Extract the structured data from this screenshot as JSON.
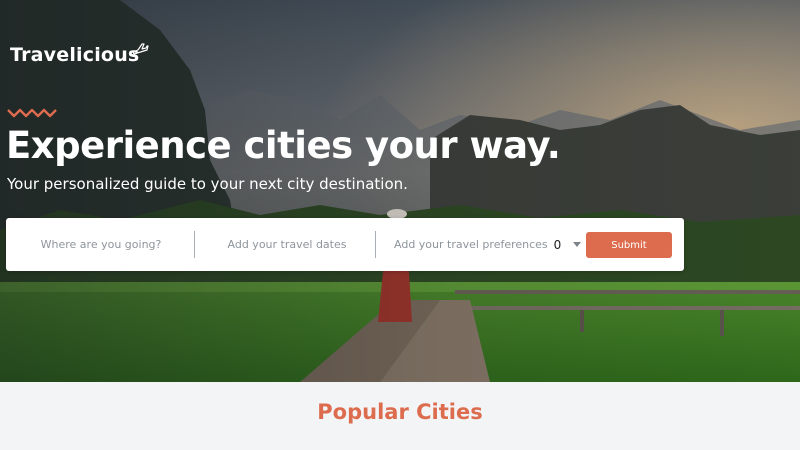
{
  "brand": {
    "name": "Travelicious",
    "icon": "airplane-icon",
    "accent": "#dd6b4d"
  },
  "hero": {
    "decoration_icon": "wave-icon",
    "headline": "Experience cities your way.",
    "subheadline": "Your personalized guide to your next city destination."
  },
  "search": {
    "destination_placeholder": "Where are you going?",
    "dates_placeholder": "Add your travel dates",
    "preferences_placeholder": "Add your travel preferences",
    "preferences_count": "0",
    "preferences_icon": "chevron-down-icon",
    "submit_label": "Submit"
  },
  "popular": {
    "title": "Popular Cities"
  }
}
